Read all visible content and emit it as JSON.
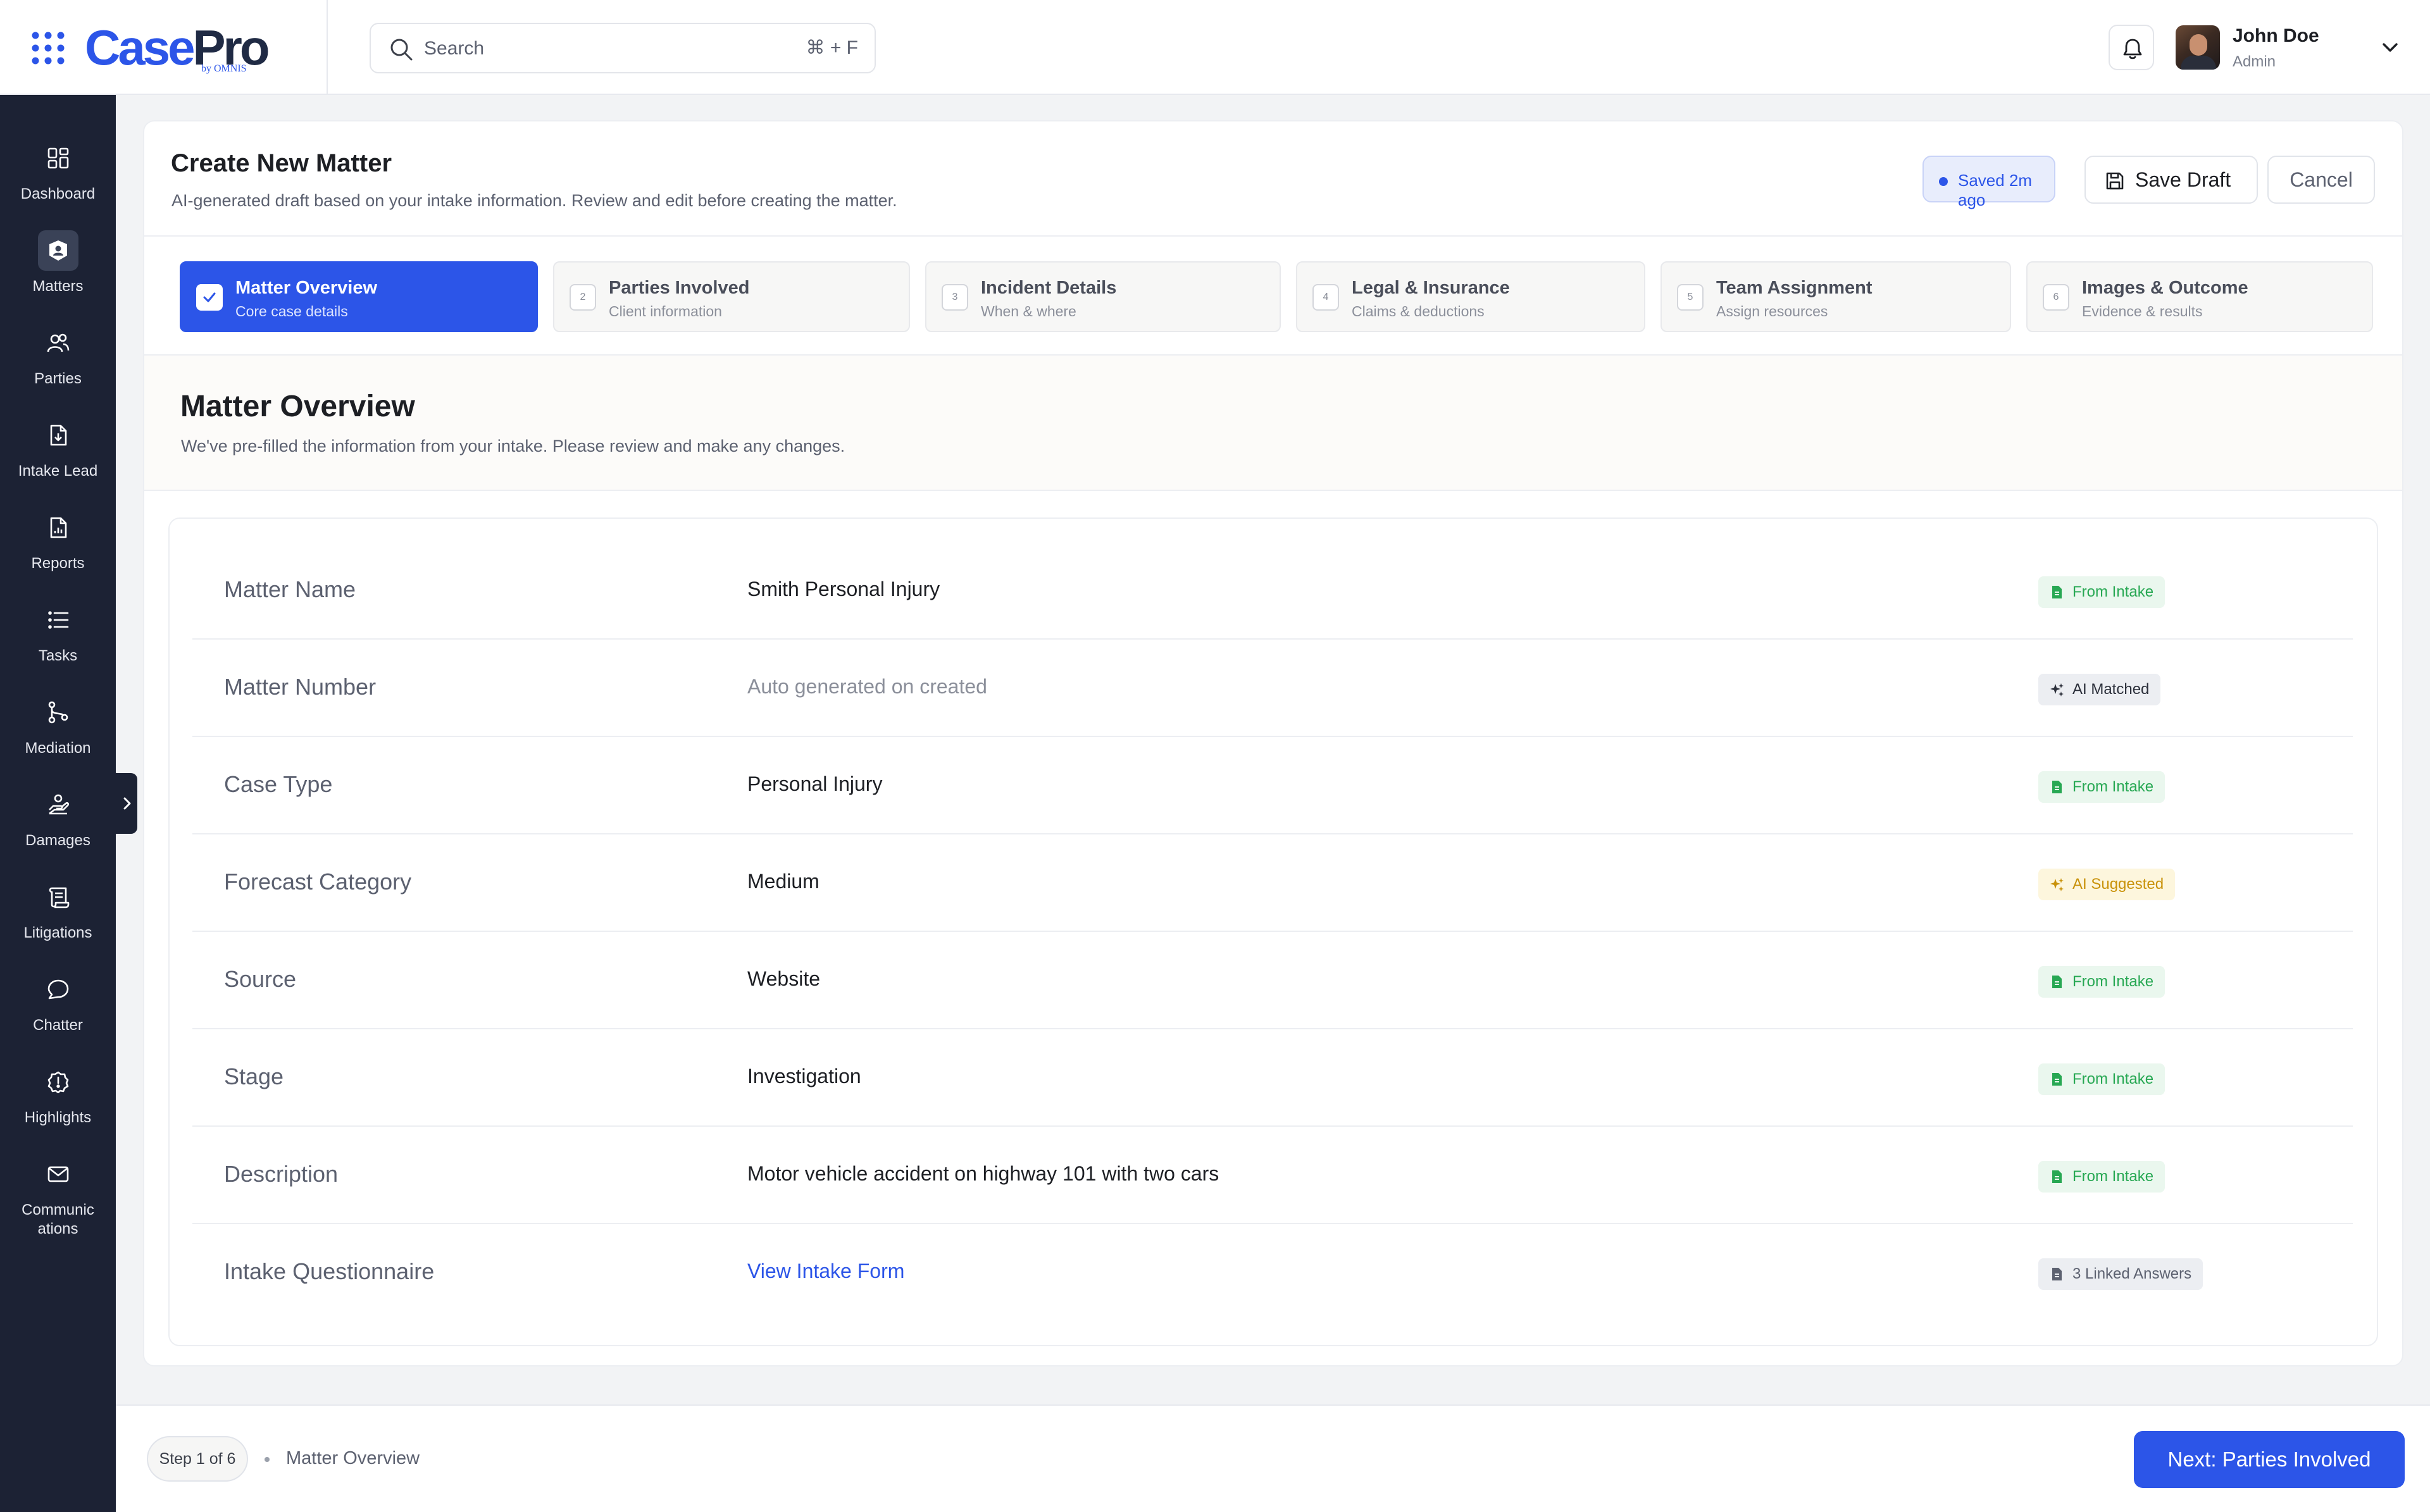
{
  "app": {
    "logo_part1": "Case",
    "logo_part2": "Pro",
    "logo_sub": "by OMNIS",
    "brand_color": "#2c55e8"
  },
  "search": {
    "placeholder": "Search",
    "shortcut": "⌘ + F"
  },
  "user": {
    "name": "John Doe",
    "role": "Admin"
  },
  "sidebar": {
    "items": [
      {
        "label": "Dashboard",
        "icon": "dashboard-icon"
      },
      {
        "label": "Matters",
        "icon": "briefcase-icon",
        "active": true
      },
      {
        "label": "Parties",
        "icon": "users-icon"
      },
      {
        "label": "Intake Lead",
        "icon": "file-download-icon"
      },
      {
        "label": "Reports",
        "icon": "report-chart-icon"
      },
      {
        "label": "Tasks",
        "icon": "list-icon"
      },
      {
        "label": "Mediation",
        "icon": "git-branch-icon"
      },
      {
        "label": "Damages",
        "icon": "hand-coin-icon"
      },
      {
        "label": "Litigations",
        "icon": "scroll-icon"
      },
      {
        "label": "Chatter",
        "icon": "chat-bubble-icon"
      },
      {
        "label": "Highlights",
        "icon": "alert-badge-icon"
      },
      {
        "label": "Communic\nations",
        "icon": "mail-icon"
      }
    ]
  },
  "header": {
    "title": "Create New Matter",
    "subtitle": "AI-generated draft based on your intake information. Review and edit before creating the matter.",
    "saved_status": "Saved 2m ago",
    "save_draft_label": "Save Draft",
    "cancel_label": "Cancel"
  },
  "steps": [
    {
      "num": "1",
      "title": "Matter Overview",
      "sub": "Core case details",
      "active": true
    },
    {
      "num": "2",
      "title": "Parties Involved",
      "sub": "Client information"
    },
    {
      "num": "3",
      "title": "Incident Details",
      "sub": "When & where"
    },
    {
      "num": "4",
      "title": "Legal & Insurance",
      "sub": "Claims & deductions"
    },
    {
      "num": "5",
      "title": "Team Assignment",
      "sub": "Assign resources"
    },
    {
      "num": "6",
      "title": "Images & Outcome",
      "sub": "Evidence & results"
    }
  ],
  "section": {
    "title": "Matter Overview",
    "subtitle": "We've pre-filled the information from your intake. Please review and make any changes."
  },
  "fields": [
    {
      "label": "Matter Name",
      "value": "Smith Personal Injury",
      "badge": "From Intake",
      "badge_type": "intake"
    },
    {
      "label": "Matter Number",
      "value": "Auto generated on created",
      "badge": "AI Matched",
      "badge_type": "matched",
      "muted": true
    },
    {
      "label": "Case Type",
      "value": "Personal Injury",
      "badge": "From Intake",
      "badge_type": "intake"
    },
    {
      "label": "Forecast Category",
      "value": "Medium",
      "badge": "AI Suggested",
      "badge_type": "suggested"
    },
    {
      "label": "Source",
      "value": "Website",
      "badge": "From Intake",
      "badge_type": "intake"
    },
    {
      "label": "Stage",
      "value": "Investigation",
      "badge": "From Intake",
      "badge_type": "intake"
    },
    {
      "label": "Description",
      "value": "Motor vehicle accident on highway 101 with two cars",
      "badge": "From Intake",
      "badge_type": "intake"
    },
    {
      "label": "Intake Questionnaire",
      "value": "View Intake Form",
      "badge": "3 Linked Answers",
      "badge_type": "linked",
      "link": true
    }
  ],
  "footer": {
    "step_indicator": "Step 1 of 6",
    "crumb": "Matter Overview",
    "next_label": "Next: Parties Involved"
  }
}
